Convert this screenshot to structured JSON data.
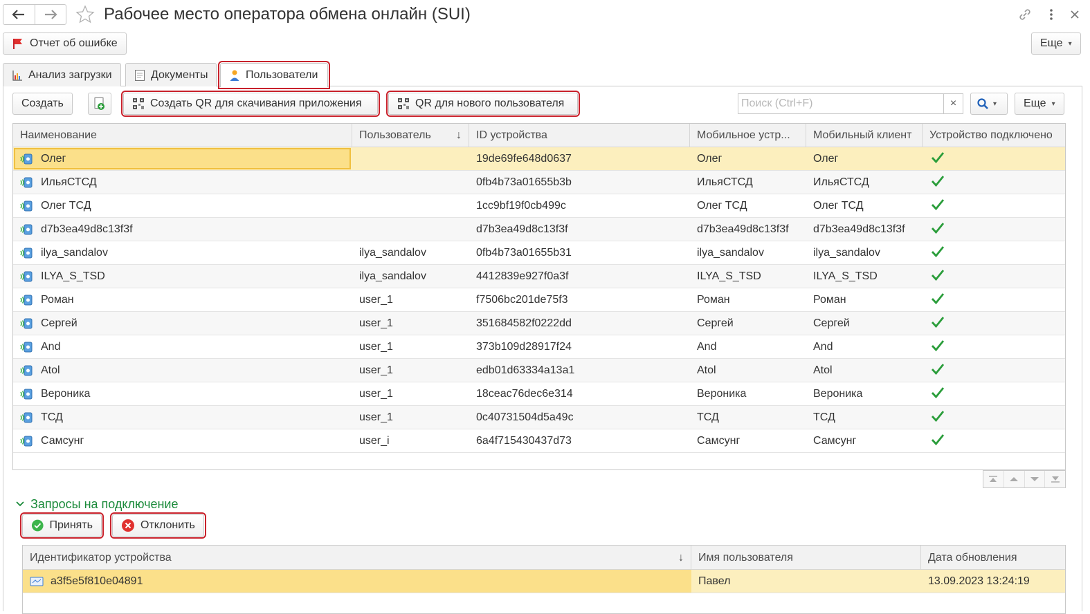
{
  "window": {
    "title": "Рабочее место оператора обмена онлайн (SUI)",
    "back_icon": "arrow-left-icon",
    "forward_icon": "arrow-right-icon"
  },
  "toolbar_top": {
    "error_report_label": "Отчет об ошибке",
    "more_label": "Еще"
  },
  "tabs": [
    {
      "label": "Анализ загрузки",
      "icon": "chart-icon",
      "active": false
    },
    {
      "label": "Документы",
      "icon": "document-icon",
      "active": false
    },
    {
      "label": "Пользователи",
      "icon": "user-icon",
      "active": true
    }
  ],
  "users_toolbar": {
    "create_label": "Создать",
    "qr_app_label": "Создать QR для скачивания приложения",
    "qr_new_user_label": "QR для нового пользователя",
    "search_placeholder": "Поиск (Ctrl+F)",
    "search_clear": "×",
    "more_label": "Еще"
  },
  "users_table": {
    "columns": [
      "Наименование",
      "Пользователь",
      "ID устройства",
      "Мобильное устр...",
      "Мобильный клиент",
      "Устройство подключено"
    ],
    "sort_indicator": "↓",
    "rows": [
      {
        "name": "Олег",
        "user": "",
        "device_id": "19de69fe648d0637",
        "mobile_device": "Олег",
        "mobile_client": "Олег",
        "connected": true,
        "selected": true
      },
      {
        "name": "ИльяСТСД",
        "user": "",
        "device_id": "0fb4b73a01655b3b",
        "mobile_device": "ИльяСТСД",
        "mobile_client": "ИльяСТСД",
        "connected": true
      },
      {
        "name": "Олег ТСД",
        "user": "",
        "device_id": "1cc9bf19f0cb499c",
        "mobile_device": "Олег ТСД",
        "mobile_client": "Олег ТСД",
        "connected": true
      },
      {
        "name": "d7b3ea49d8c13f3f",
        "user": "",
        "device_id": "d7b3ea49d8c13f3f",
        "mobile_device": "d7b3ea49d8c13f3f",
        "mobile_client": "d7b3ea49d8c13f3f",
        "connected": true
      },
      {
        "name": "ilya_sandalov",
        "user": "ilya_sandalov",
        "device_id": "0fb4b73a01655b31",
        "mobile_device": "ilya_sandalov",
        "mobile_client": "ilya_sandalov",
        "connected": true
      },
      {
        "name": "ILYA_S_TSD",
        "user": "ilya_sandalov",
        "device_id": "4412839e927f0a3f",
        "mobile_device": "ILYA_S_TSD",
        "mobile_client": "ILYA_S_TSD",
        "connected": true
      },
      {
        "name": "Роман",
        "user": "user_1",
        "device_id": "f7506bc201de75f3",
        "mobile_device": "Роман",
        "mobile_client": "Роман",
        "connected": true
      },
      {
        "name": "Сергей",
        "user": "user_1",
        "device_id": "351684582f0222dd",
        "mobile_device": "Сергей",
        "mobile_client": "Сергей",
        "connected": true
      },
      {
        "name": "And",
        "user": "user_1",
        "device_id": "373b109d28917f24",
        "mobile_device": "And",
        "mobile_client": "And",
        "connected": true
      },
      {
        "name": "Atol",
        "user": "user_1",
        "device_id": "edb01d63334a13a1",
        "mobile_device": "Atol",
        "mobile_client": "Atol",
        "connected": true
      },
      {
        "name": "Вероника",
        "user": "user_1",
        "device_id": "18ceac76dec6e314",
        "mobile_device": "Вероника",
        "mobile_client": "Вероника",
        "connected": true
      },
      {
        "name": "ТСД",
        "user": "user_1",
        "device_id": "0c40731504d5a49c",
        "mobile_device": "ТСД",
        "mobile_client": "ТСД",
        "connected": true
      },
      {
        "name": "Самсунг",
        "user": "user_i",
        "device_id": "6a4f715430437d73",
        "mobile_device": "Самсунг",
        "mobile_client": "Самсунг",
        "connected": true
      }
    ]
  },
  "requests_section": {
    "title": "Запросы на подключение",
    "accept_label": "Принять",
    "reject_label": "Отклонить",
    "columns": [
      "Идентификатор устройства",
      "Имя пользователя",
      "Дата обновления"
    ],
    "sort_indicator": "↓",
    "rows": [
      {
        "device_id": "a3f5e5f810e04891",
        "user_name": "Павел",
        "updated": "13.09.2023 13:24:19"
      }
    ]
  },
  "colors": {
    "accent_green": "#1a8a3a",
    "highlight_red": "#c8212b",
    "selected_row": "#fcefbe",
    "check_green": "#2a9d3a"
  }
}
